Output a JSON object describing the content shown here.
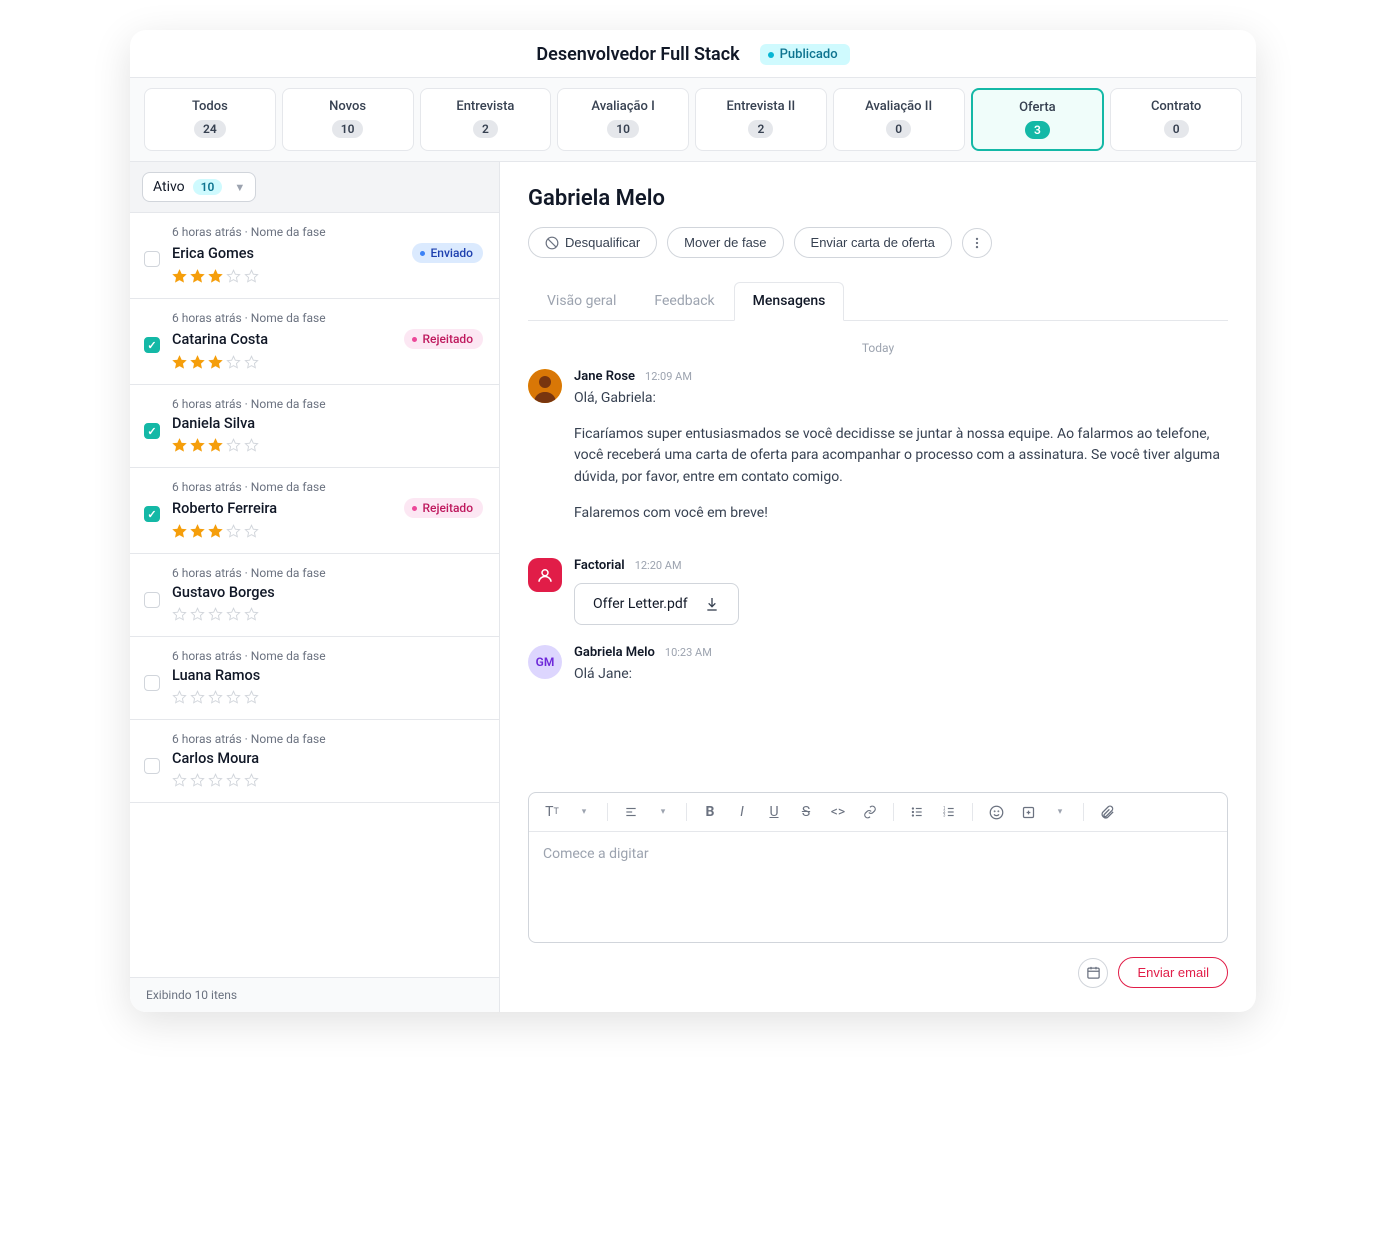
{
  "header": {
    "title": "Desenvolvedor Full Stack",
    "status": "Publicado"
  },
  "stages": [
    {
      "label": "Todos",
      "count": "24",
      "active": false
    },
    {
      "label": "Novos",
      "count": "10",
      "active": false
    },
    {
      "label": "Entrevista",
      "count": "2",
      "active": false
    },
    {
      "label": "Avaliação I",
      "count": "10",
      "active": false
    },
    {
      "label": "Entrevista II",
      "count": "2",
      "active": false
    },
    {
      "label": "Avaliação II",
      "count": "0",
      "active": false
    },
    {
      "label": "Oferta",
      "count": "3",
      "active": true
    },
    {
      "label": "Contrato",
      "count": "0",
      "active": false
    }
  ],
  "filter": {
    "label": "Ativo",
    "count": "10"
  },
  "candidates": [
    {
      "meta": "6 horas atrás · Nome da fase",
      "name": "Erica Gomes",
      "rating": 3,
      "checked": false,
      "pill": {
        "text": "Enviado",
        "style": "sent"
      }
    },
    {
      "meta": "6 horas atrás · Nome da fase",
      "name": "Catarina Costa",
      "rating": 3,
      "checked": true,
      "pill": {
        "text": "Rejeitado",
        "style": "rejected"
      }
    },
    {
      "meta": "6 horas atrás · Nome da fase",
      "name": "Daniela Silva",
      "rating": 3,
      "checked": true,
      "pill": null
    },
    {
      "meta": "6 horas atrás · Nome da fase",
      "name": "Roberto Ferreira",
      "rating": 3,
      "checked": true,
      "pill": {
        "text": "Rejeitado",
        "style": "rejected"
      }
    },
    {
      "meta": "6 horas atrás · Nome da fase",
      "name": "Gustavo Borges",
      "rating": 0,
      "checked": false,
      "pill": null
    },
    {
      "meta": "6 horas atrás · Nome da fase",
      "name": "Luana Ramos",
      "rating": 0,
      "checked": false,
      "pill": null
    },
    {
      "meta": "6 horas atrás · Nome da fase",
      "name": "Carlos Moura",
      "rating": 0,
      "checked": false,
      "pill": null
    }
  ],
  "list_footer": "Exibindo 10 itens",
  "detail": {
    "name": "Gabriela Melo",
    "actions": {
      "disqualify": "Desqualificar",
      "move": "Mover de fase",
      "send_offer": "Enviar carta de oferta"
    },
    "tabs": [
      {
        "label": "Visão geral",
        "active": false
      },
      {
        "label": "Feedback",
        "active": false
      },
      {
        "label": "Mensagens",
        "active": true
      }
    ],
    "day": "Today",
    "messages": [
      {
        "avatar": "jane",
        "sender": "Jane Rose",
        "time": "12:09 AM",
        "paragraphs": [
          "Olá, Gabriela:",
          "Ficaríamos super entusiasmados se você decidisse se juntar à nossa equipe. Ao falarmos ao telefone, você receberá uma carta de oferta para acompanhar o processo com a assinatura. Se você tiver alguma dúvida, por favor, entre em contato comigo.",
          "Falaremos com você em breve!"
        ]
      },
      {
        "avatar": "factorial",
        "sender": "Factorial",
        "time": "12:20 AM",
        "attachment": "Offer Letter.pdf"
      },
      {
        "avatar": "gm",
        "avatar_initials": "GM",
        "sender": "Gabriela Melo",
        "time": "10:23 AM",
        "paragraphs": [
          "Olá Jane:"
        ]
      }
    ],
    "composer_placeholder": "Comece a digitar",
    "send_button": "Enviar email"
  }
}
